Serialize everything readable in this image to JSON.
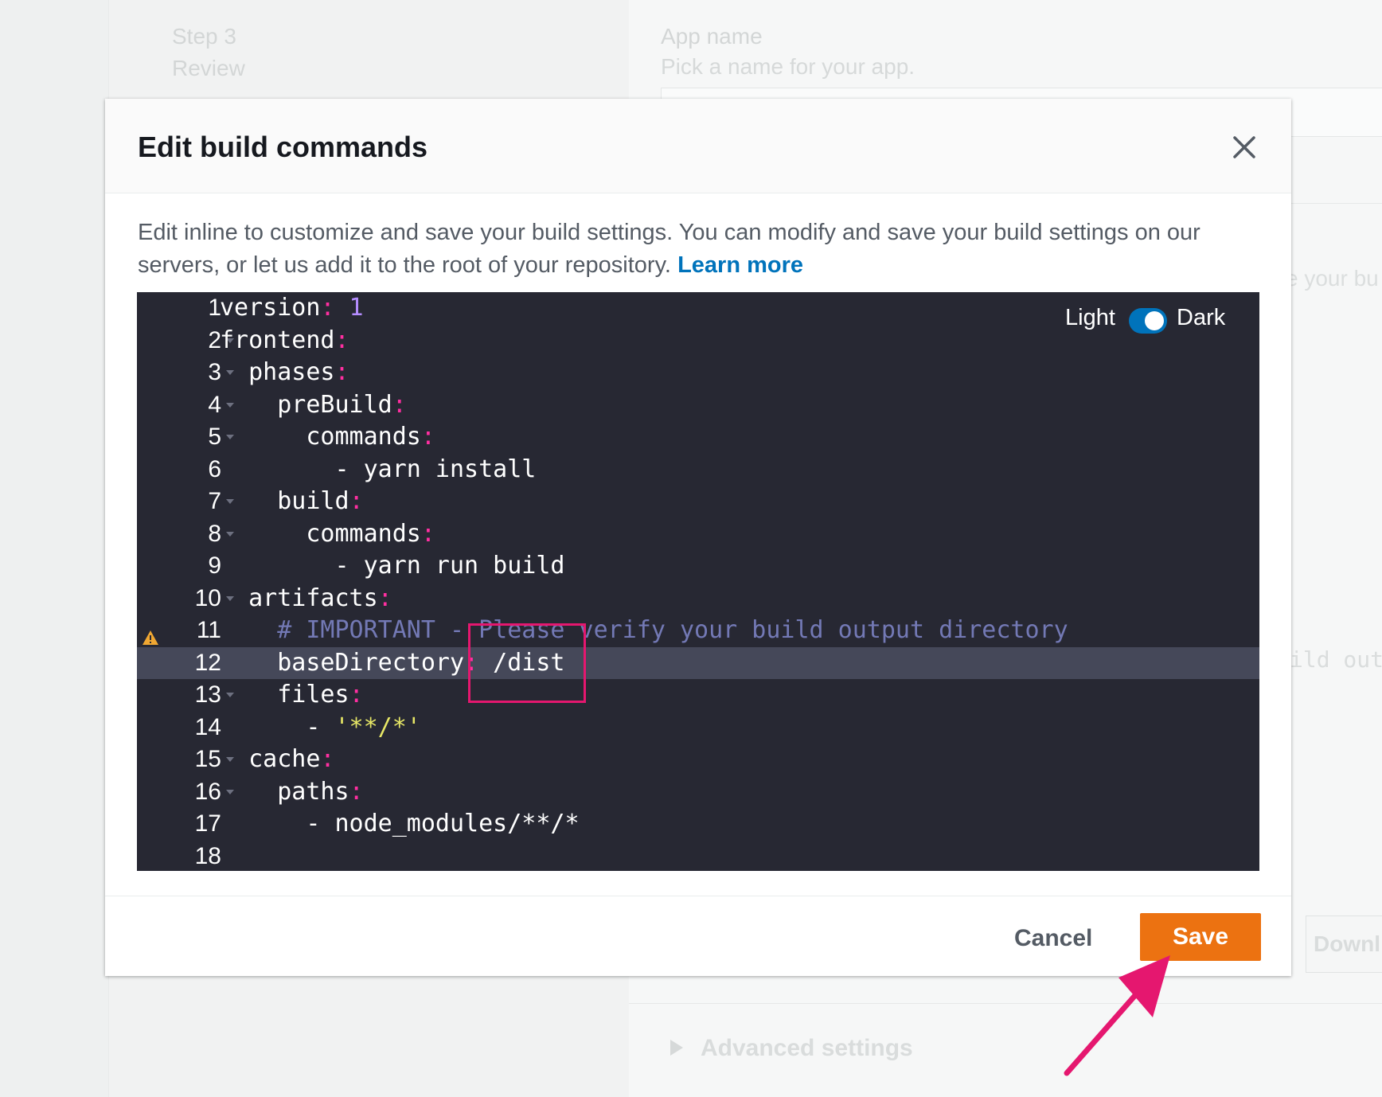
{
  "background": {
    "step_title": "Step 3",
    "step_subtitle": "Review",
    "app_name_label": "App name",
    "app_name_hint": "Pick a name for your app.",
    "panel_text_fragment": "e your bu",
    "code_fragment": "ild out",
    "download_fragment": "Downl",
    "advanced_settings": "Advanced settings"
  },
  "modal": {
    "title": "Edit build commands",
    "description": "Edit inline to customize and save your build settings. You can modify and save your build settings on our servers, or let us add it to the root of your repository.",
    "learn_more": "Learn more",
    "theme": {
      "light_label": "Light",
      "dark_label": "Dark",
      "dark_enabled": true
    },
    "buttons": {
      "cancel": "Cancel",
      "save": "Save"
    },
    "colors": {
      "accent": "#ec7211",
      "link": "#0073bb",
      "editor_bg": "#272833",
      "annotation": "#e5176f"
    }
  },
  "editor": {
    "active_line": 12,
    "warning_line": 11,
    "lines": [
      {
        "n": "1",
        "text": "version: 1"
      },
      {
        "n": "2",
        "text": "frontend:"
      },
      {
        "n": "3",
        "text": "  phases:"
      },
      {
        "n": "4",
        "text": "    preBuild:"
      },
      {
        "n": "5",
        "text": "      commands:"
      },
      {
        "n": "6",
        "text": "        - yarn install"
      },
      {
        "n": "7",
        "text": "    build:"
      },
      {
        "n": "8",
        "text": "      commands:"
      },
      {
        "n": "9",
        "text": "        - yarn run build"
      },
      {
        "n": "10",
        "text": "  artifacts:"
      },
      {
        "n": "11",
        "text": "    # IMPORTANT - Please verify your build output directory"
      },
      {
        "n": "12",
        "text": "    baseDirectory: /dist"
      },
      {
        "n": "13",
        "text": "    files:"
      },
      {
        "n": "14",
        "text": "      - '**/*'"
      },
      {
        "n": "15",
        "text": "  cache:"
      },
      {
        "n": "16",
        "text": "    paths:"
      },
      {
        "n": "17",
        "text": "      - node_modules/**/*"
      },
      {
        "n": "18",
        "text": ""
      }
    ]
  }
}
